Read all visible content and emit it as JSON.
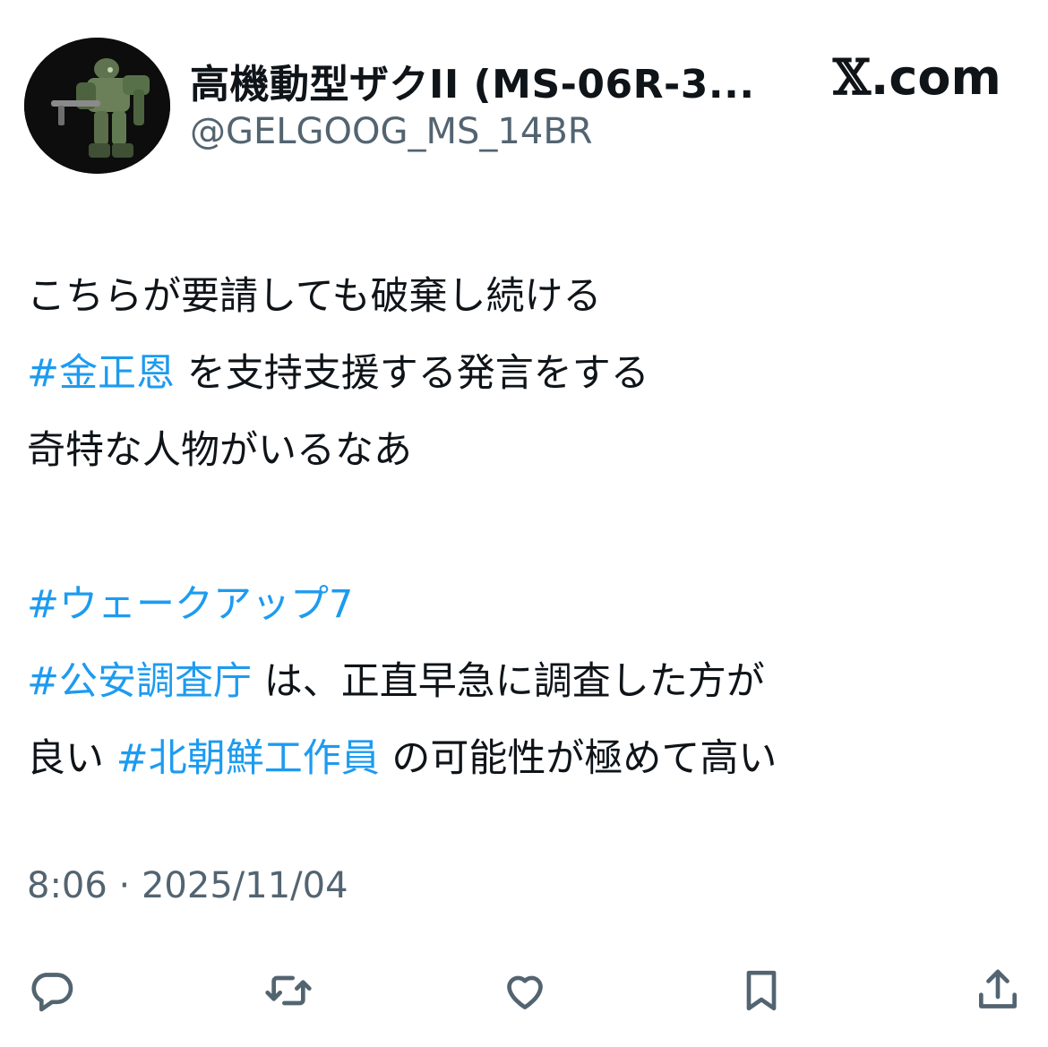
{
  "header": {
    "display_name": "高機動型ザクII (MS-06R-3...",
    "handle": "@GELGOOG_MS_14BR",
    "brand_x": "𝕏",
    "brand_domain": ".com"
  },
  "tweet": {
    "line1": "こちらが要請しても破棄し続ける",
    "line2_tag": "#金正恩",
    "line2_text": " を支持支援する発言をする",
    "line3": "奇特な人物がいるなあ",
    "line5_tag": "#ウェークアップ7",
    "line6_tag": "#公安調査庁",
    "line6_text": " は、正直早急に調査した方が",
    "line7_text_a": "良い ",
    "line7_tag": "#北朝鮮工作員",
    "line7_text_b": " の可能性が極めて高い"
  },
  "timestamp": "8:06 · 2025/11/04",
  "icons": {
    "reply": "reply-icon",
    "retweet": "retweet-icon",
    "like": "like-icon",
    "bookmark": "bookmark-icon",
    "share": "share-icon"
  },
  "colors": {
    "hashtag": "#1d9bf0",
    "secondary_text": "#536471",
    "primary_text": "#0f1419"
  }
}
